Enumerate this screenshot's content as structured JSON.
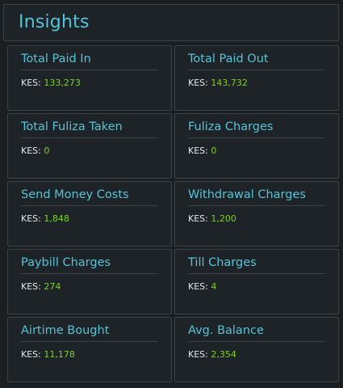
{
  "header": {
    "title": "Insights"
  },
  "currency_label": "KES:",
  "cards": [
    {
      "title": "Total Paid In",
      "value": "133,273"
    },
    {
      "title": "Total Paid Out",
      "value": "143,732"
    },
    {
      "title": "Total Fuliza Taken",
      "value": "0"
    },
    {
      "title": "Fuliza Charges",
      "value": "0"
    },
    {
      "title": "Send Money Costs",
      "value": "1,848"
    },
    {
      "title": "Withdrawal Charges",
      "value": "1,200"
    },
    {
      "title": "Paybill Charges",
      "value": "274"
    },
    {
      "title": "Till Charges",
      "value": "4"
    },
    {
      "title": "Airtime Bought",
      "value": "11,178"
    },
    {
      "title": "Avg. Balance",
      "value": "2,354"
    }
  ],
  "colors": {
    "background": "#1b1f22",
    "card_background": "#1d2327",
    "border": "#3c4449",
    "title": "#55c4d8",
    "amount": "#7ed21e",
    "label": "#e6e9ea"
  }
}
